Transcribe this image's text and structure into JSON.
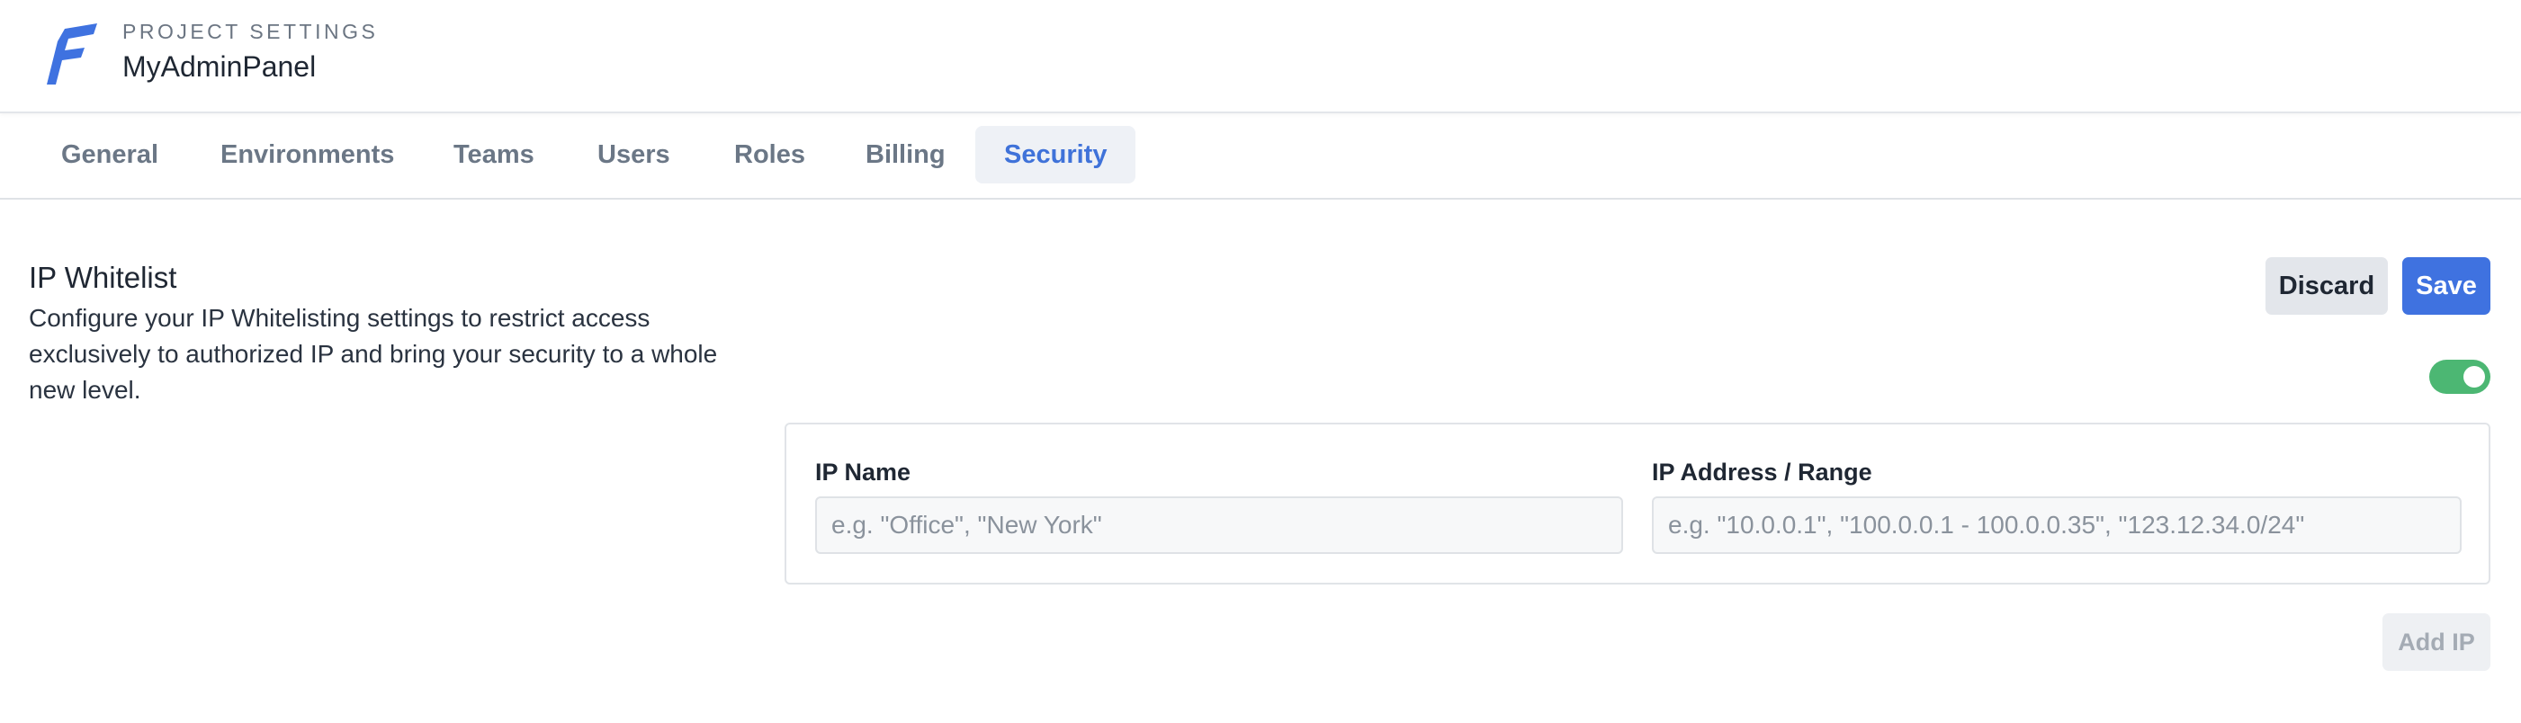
{
  "header": {
    "logo_icon": "brand-logo-icon",
    "caption": "PROJECT SETTINGS",
    "title": "MyAdminPanel"
  },
  "tabs": [
    {
      "label": "General",
      "active": false
    },
    {
      "label": "Environments",
      "active": false
    },
    {
      "label": "Teams",
      "active": false
    },
    {
      "label": "Users",
      "active": false
    },
    {
      "label": "Roles",
      "active": false
    },
    {
      "label": "Billing",
      "active": false
    },
    {
      "label": "Security",
      "active": true
    }
  ],
  "section": {
    "title": "IP Whitelist",
    "description": "Configure your IP Whitelisting settings to restrict access exclusively to authorized IP and bring your security to a whole new level.",
    "discard_label": "Discard",
    "save_label": "Save",
    "toggle_enabled": true
  },
  "form": {
    "ip_name_label": "IP Name",
    "ip_name_value": "",
    "ip_name_placeholder": "e.g. \"Office\", \"New York\"",
    "ip_address_label": "IP Address / Range",
    "ip_address_value": "",
    "ip_address_placeholder": "e.g. \"10.0.0.1\", \"100.0.0.1 - 100.0.0.35\", \"123.12.34.0/24\"",
    "add_label": "Add IP",
    "add_disabled": true
  },
  "colors": {
    "accent": "#3f72e0",
    "toggle_on": "#4cb773",
    "active_tab_bg": "#eef1f6"
  }
}
